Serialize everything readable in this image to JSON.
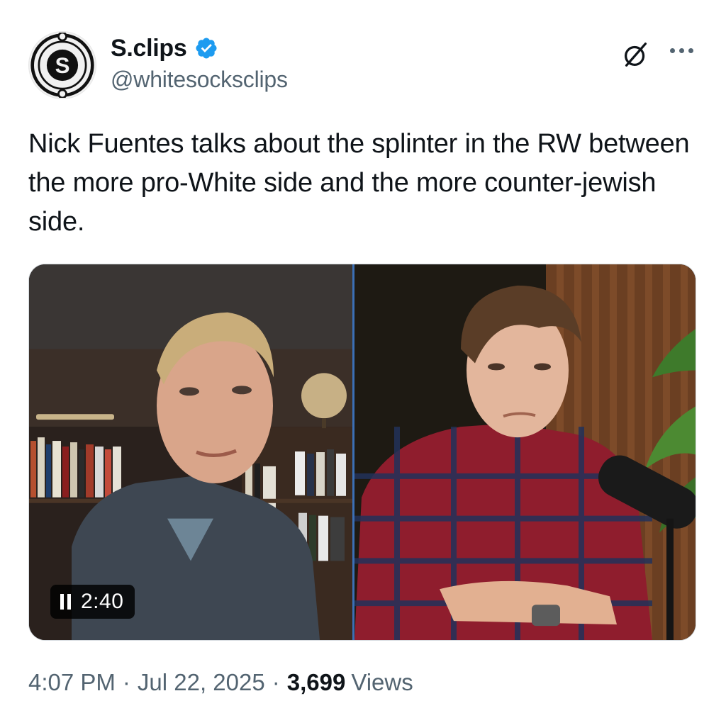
{
  "author": {
    "display_name": "S.clips",
    "handle": "@whitesocksclips",
    "avatar_letter": "S",
    "avatar_icon": "s-logo-icon",
    "verified_icon": "verified-badge-icon",
    "verified_color": "#1d9bf0"
  },
  "tweet": {
    "text": "Nick Fuentes talks about the splinter in the RW between the more pro-White side and the more counter-jewish side."
  },
  "media": {
    "type": "video",
    "time_remaining": "2:40",
    "playback_icon": "pause-icon"
  },
  "meta": {
    "time": "4:07 PM",
    "separator": "·",
    "date": "Jul 22, 2025",
    "views_count": "3,699",
    "views_label": "Views"
  },
  "toolbar": {
    "grok_icon": "grok-icon",
    "more_icon": "more-icon"
  },
  "colors": {
    "text_primary": "#0f1419",
    "text_secondary": "#536471",
    "accent": "#1d9bf0"
  }
}
